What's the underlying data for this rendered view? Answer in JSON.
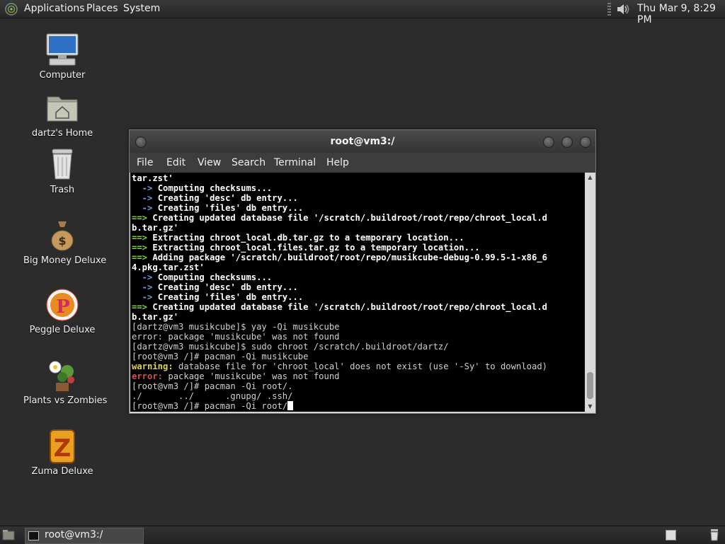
{
  "top_panel": {
    "menus": [
      "Applications",
      "Places",
      "System"
    ],
    "clock": "Thu Mar  9,  8:29 PM",
    "icons": [
      "main-menu-logo-icon",
      "volume-icon"
    ]
  },
  "desktop_icons": [
    {
      "label": "Computer",
      "icon": "computer-icon"
    },
    {
      "label": "dartz's Home",
      "icon": "home-folder-icon"
    },
    {
      "label": "Trash",
      "icon": "trash-icon"
    },
    {
      "label": "Big Money Deluxe",
      "icon": "money-bag-icon"
    },
    {
      "label": "Peggle Deluxe",
      "icon": "peggle-icon"
    },
    {
      "label": "Plants vs Zombies",
      "icon": "plants-vs-zombies-icon"
    },
    {
      "label": "Zuma Deluxe",
      "icon": "zuma-icon"
    }
  ],
  "terminal": {
    "title": "root@vm3:/",
    "menu": [
      "File",
      "Edit",
      "View",
      "Search",
      "Terminal",
      "Help"
    ],
    "lines": [
      {
        "type": "plain-bold",
        "text": "tar.zst'"
      },
      {
        "type": "sub",
        "text": "Computing checksums..."
      },
      {
        "type": "sub",
        "text": "Creating 'desc' db entry..."
      },
      {
        "type": "sub",
        "text": "Creating 'files' db entry..."
      },
      {
        "type": "main",
        "text": "Creating updated database file '/scratch/.buildroot/root/repo/chroot_local.d"
      },
      {
        "type": "plain-bold",
        "text": "b.tar.gz'"
      },
      {
        "type": "main",
        "text": "Extracting chroot_local.db.tar.gz to a temporary location..."
      },
      {
        "type": "main",
        "text": "Extracting chroot_local.files.tar.gz to a temporary location..."
      },
      {
        "type": "main",
        "text": "Adding package '/scratch/.buildroot/root/repo/musikcube-debug-0.99.5-1-x86_6"
      },
      {
        "type": "plain-bold",
        "text": "4.pkg.tar.zst'"
      },
      {
        "type": "sub",
        "text": "Computing checksums..."
      },
      {
        "type": "sub",
        "text": "Creating 'desc' db entry..."
      },
      {
        "type": "sub",
        "text": "Creating 'files' db entry..."
      },
      {
        "type": "main",
        "text": "Creating updated database file '/scratch/.buildroot/root/repo/chroot_local.d"
      },
      {
        "type": "plain-bold",
        "text": "b.tar.gz'"
      },
      {
        "type": "plain",
        "text": "[dartz@vm3 musikcube]$ yay -Qi musikcube"
      },
      {
        "type": "plain",
        "text": "error: package 'musikcube' was not found"
      },
      {
        "type": "plain",
        "text": "[dartz@vm3 musikcube]$ sudo chroot /scratch/.buildroot/dartz/"
      },
      {
        "type": "plain",
        "text": "[root@vm3 /]# pacman -Qi musikcube"
      },
      {
        "type": "warning",
        "prefix": "warning:",
        "text": " database file for 'chroot_local' does not exist (use '-Sy' to download)"
      },
      {
        "type": "error",
        "prefix": "error:",
        "text": " package 'musikcube' was not found"
      },
      {
        "type": "plain",
        "text": "[root@vm3 /]# pacman -Qi root/."
      },
      {
        "type": "plain",
        "text": "./       ../      .gnupg/ .ssh/"
      },
      {
        "type": "prompt",
        "text": "[root@vm3 /]# pacman -Qi root/"
      }
    ],
    "arrow_main": "==>",
    "arrow_sub": "  ->"
  },
  "bottom_panel": {
    "task_label": "root@vm3:/",
    "icons": [
      "show-desktop-icon",
      "terminal-icon",
      "workspace-switcher-icon",
      "trash-icon"
    ]
  },
  "colors": {
    "arrow_main": "#7fd13b",
    "arrow_sub": "#6b9fe0",
    "warning": "#e3d34a",
    "error": "#e04a4a"
  }
}
